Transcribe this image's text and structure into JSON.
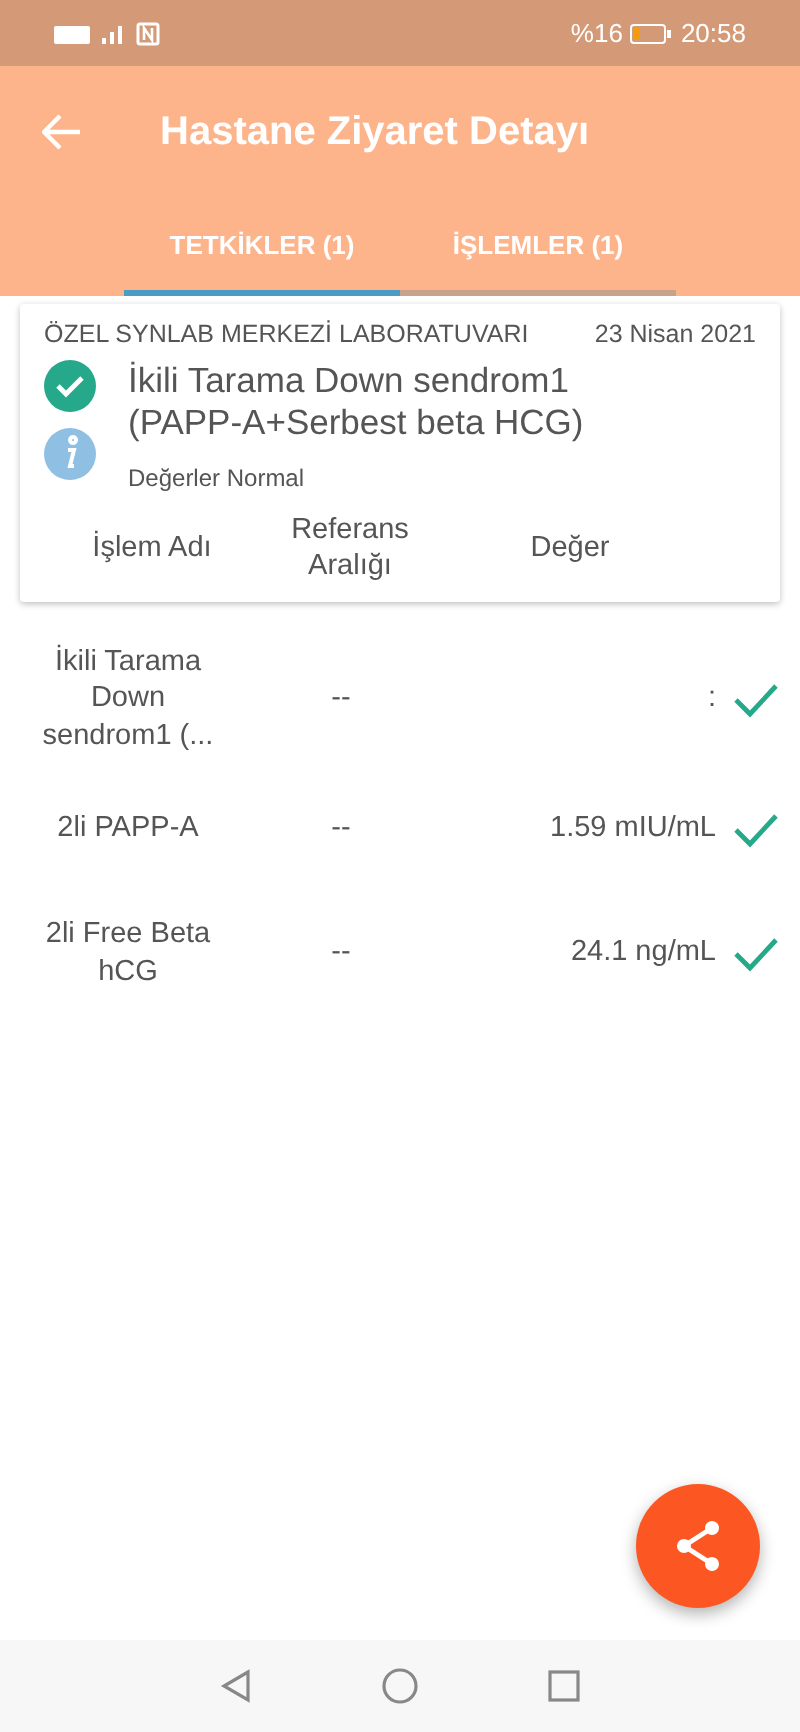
{
  "status_bar": {
    "battery_percent": "%16",
    "time": "20:58"
  },
  "header": {
    "title": "Hastane Ziyaret Detayı"
  },
  "tabs": [
    {
      "label": "TETKİKLER (1)",
      "selected": true
    },
    {
      "label": "İŞLEMLER (1)",
      "selected": false
    }
  ],
  "card": {
    "lab": "ÖZEL SYNLAB MERKEZİ LABORATUVARI",
    "date": "23 Nisan 2021",
    "test_name": "İkili Tarama Down sendrom1 (PAPP-A+Serbest beta HCG)",
    "result_note": "Değerler Normal",
    "columns": [
      "İşlem Adı",
      "Referans Aralığı",
      "Değer"
    ]
  },
  "rows": [
    {
      "name": "İkili Tarama Down sendrom1 (...",
      "reference": "--",
      "value": ":",
      "normal": true
    },
    {
      "name": "2li PAPP-A",
      "reference": "--",
      "value": "1.59 mIU/mL",
      "normal": true
    },
    {
      "name": "2li Free Beta hCG",
      "reference": "--",
      "value": "24.1 ng/mL",
      "normal": true
    }
  ]
}
